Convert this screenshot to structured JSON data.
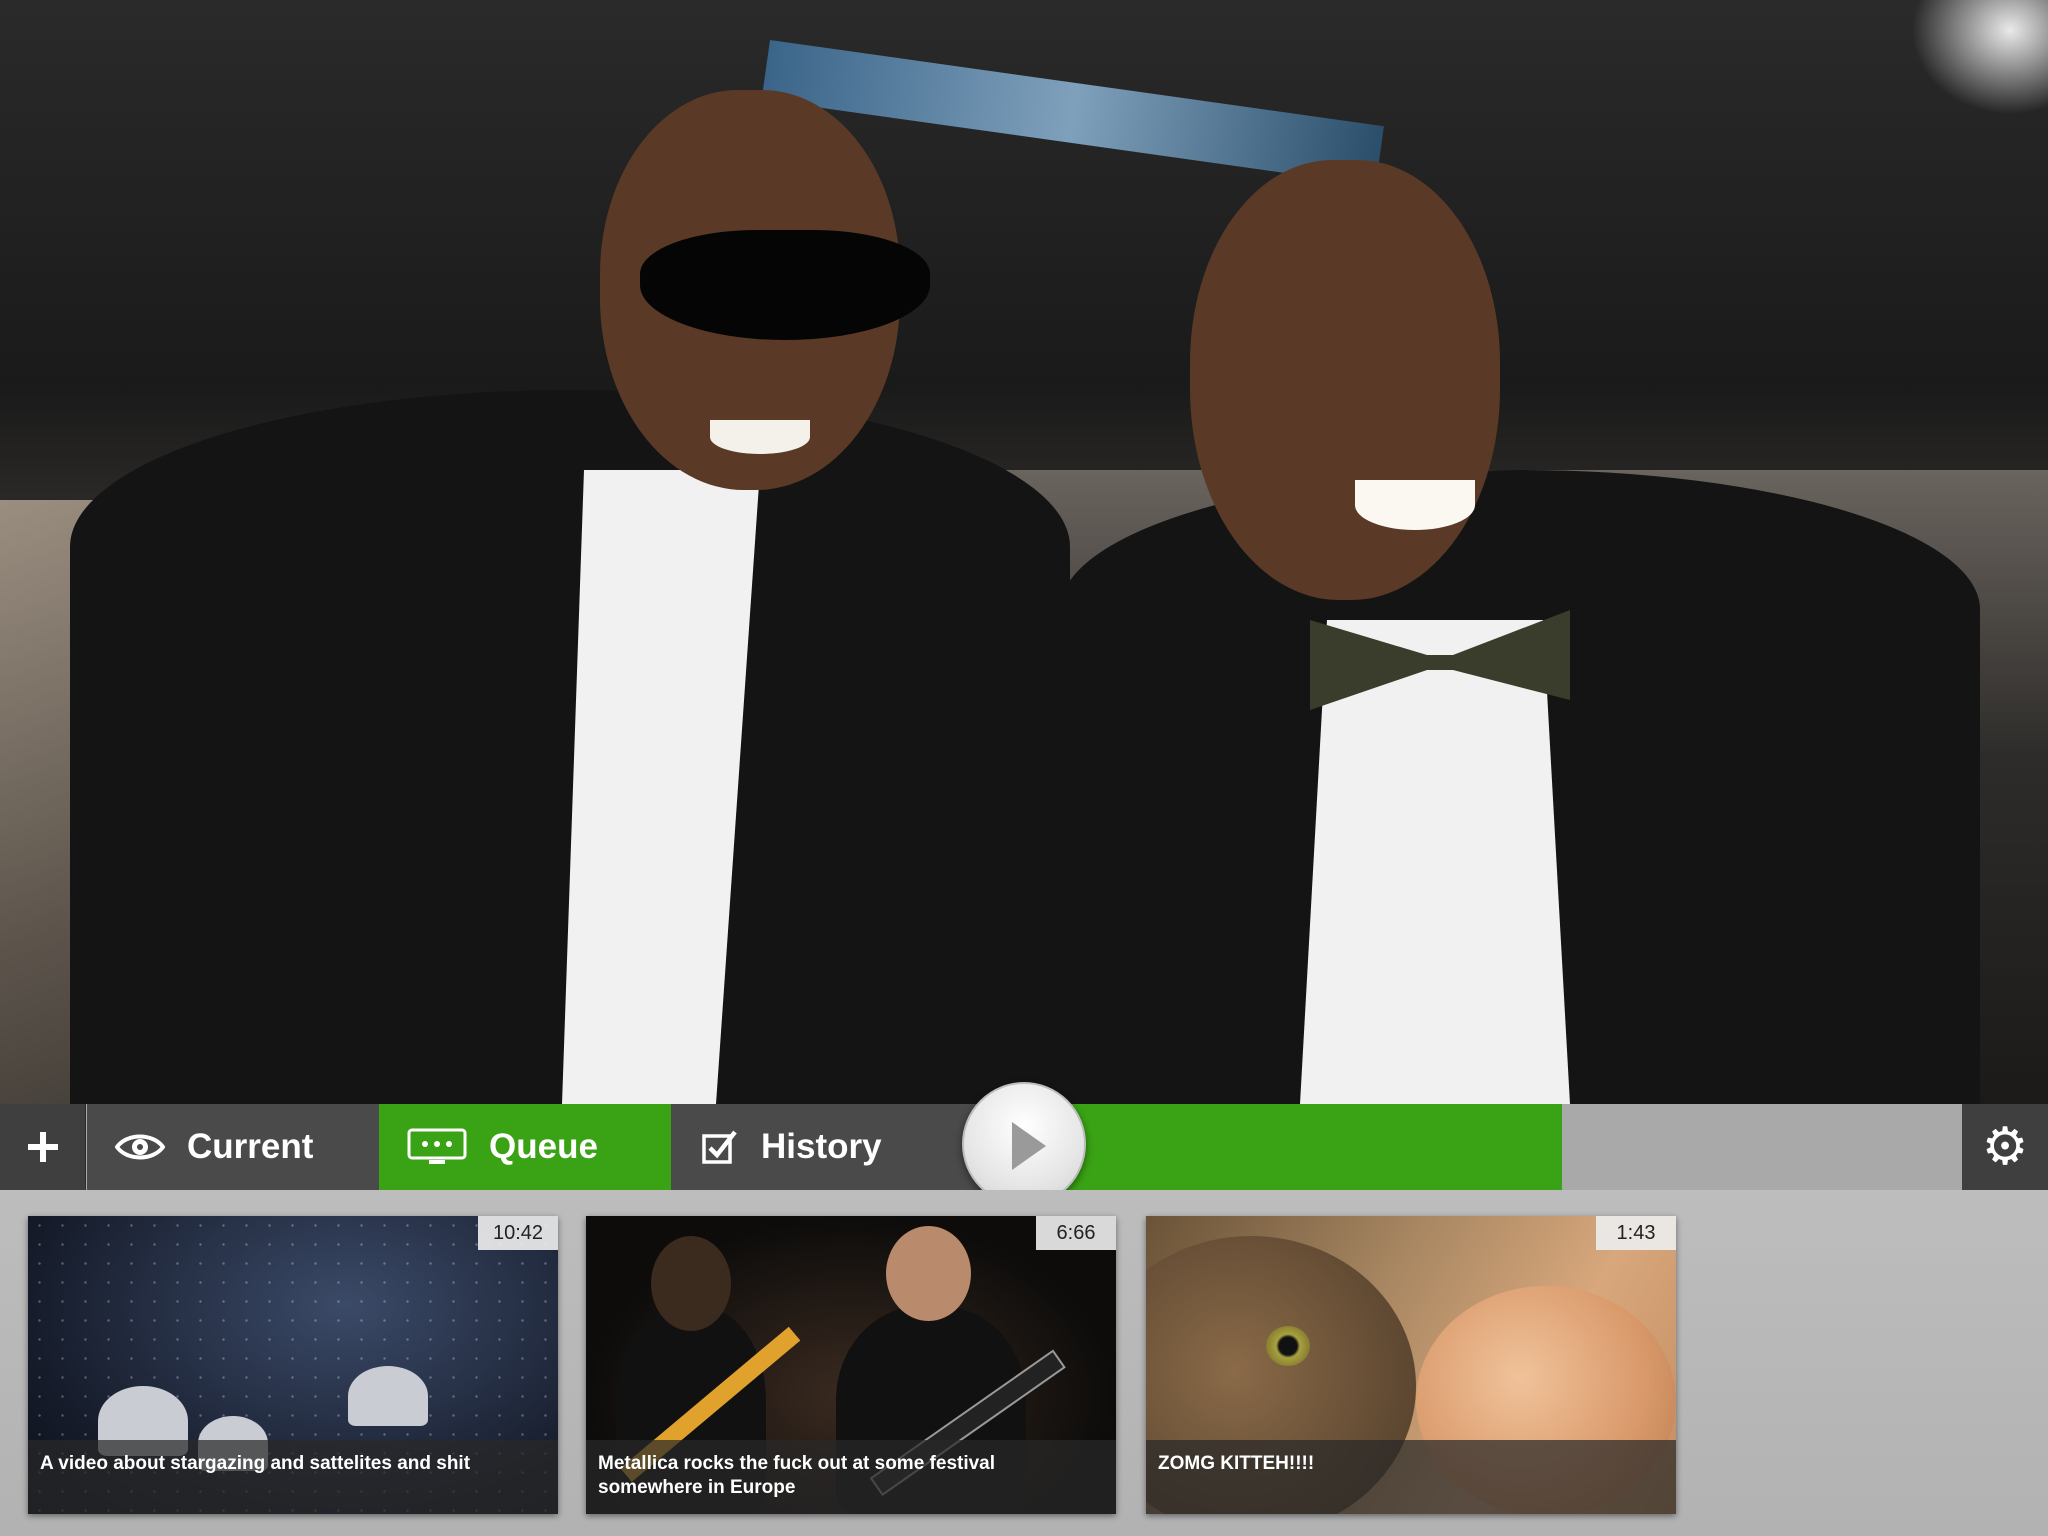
{
  "tabs": {
    "add_label": "+",
    "current_label": "Current",
    "queue_label": "Queue",
    "history_label": "History",
    "active_tab": "Queue"
  },
  "player": {
    "progress": 0.9,
    "accent_color": "#3aa315"
  },
  "videos": [
    {
      "title": "A video about stargazing and sattelites and shit",
      "duration": "10:42"
    },
    {
      "title": "Metallica rocks the fuck out at some festival somewhere in Europe",
      "duration": "6:66"
    },
    {
      "title": "ZOMG KITTEH!!!!",
      "duration": "1:43"
    }
  ],
  "icons": {
    "add": "plus-icon",
    "current": "eye-icon",
    "queue": "tv-queue-icon",
    "history": "checkbox-icon",
    "play": "play-icon",
    "settings": "gear-icon"
  }
}
